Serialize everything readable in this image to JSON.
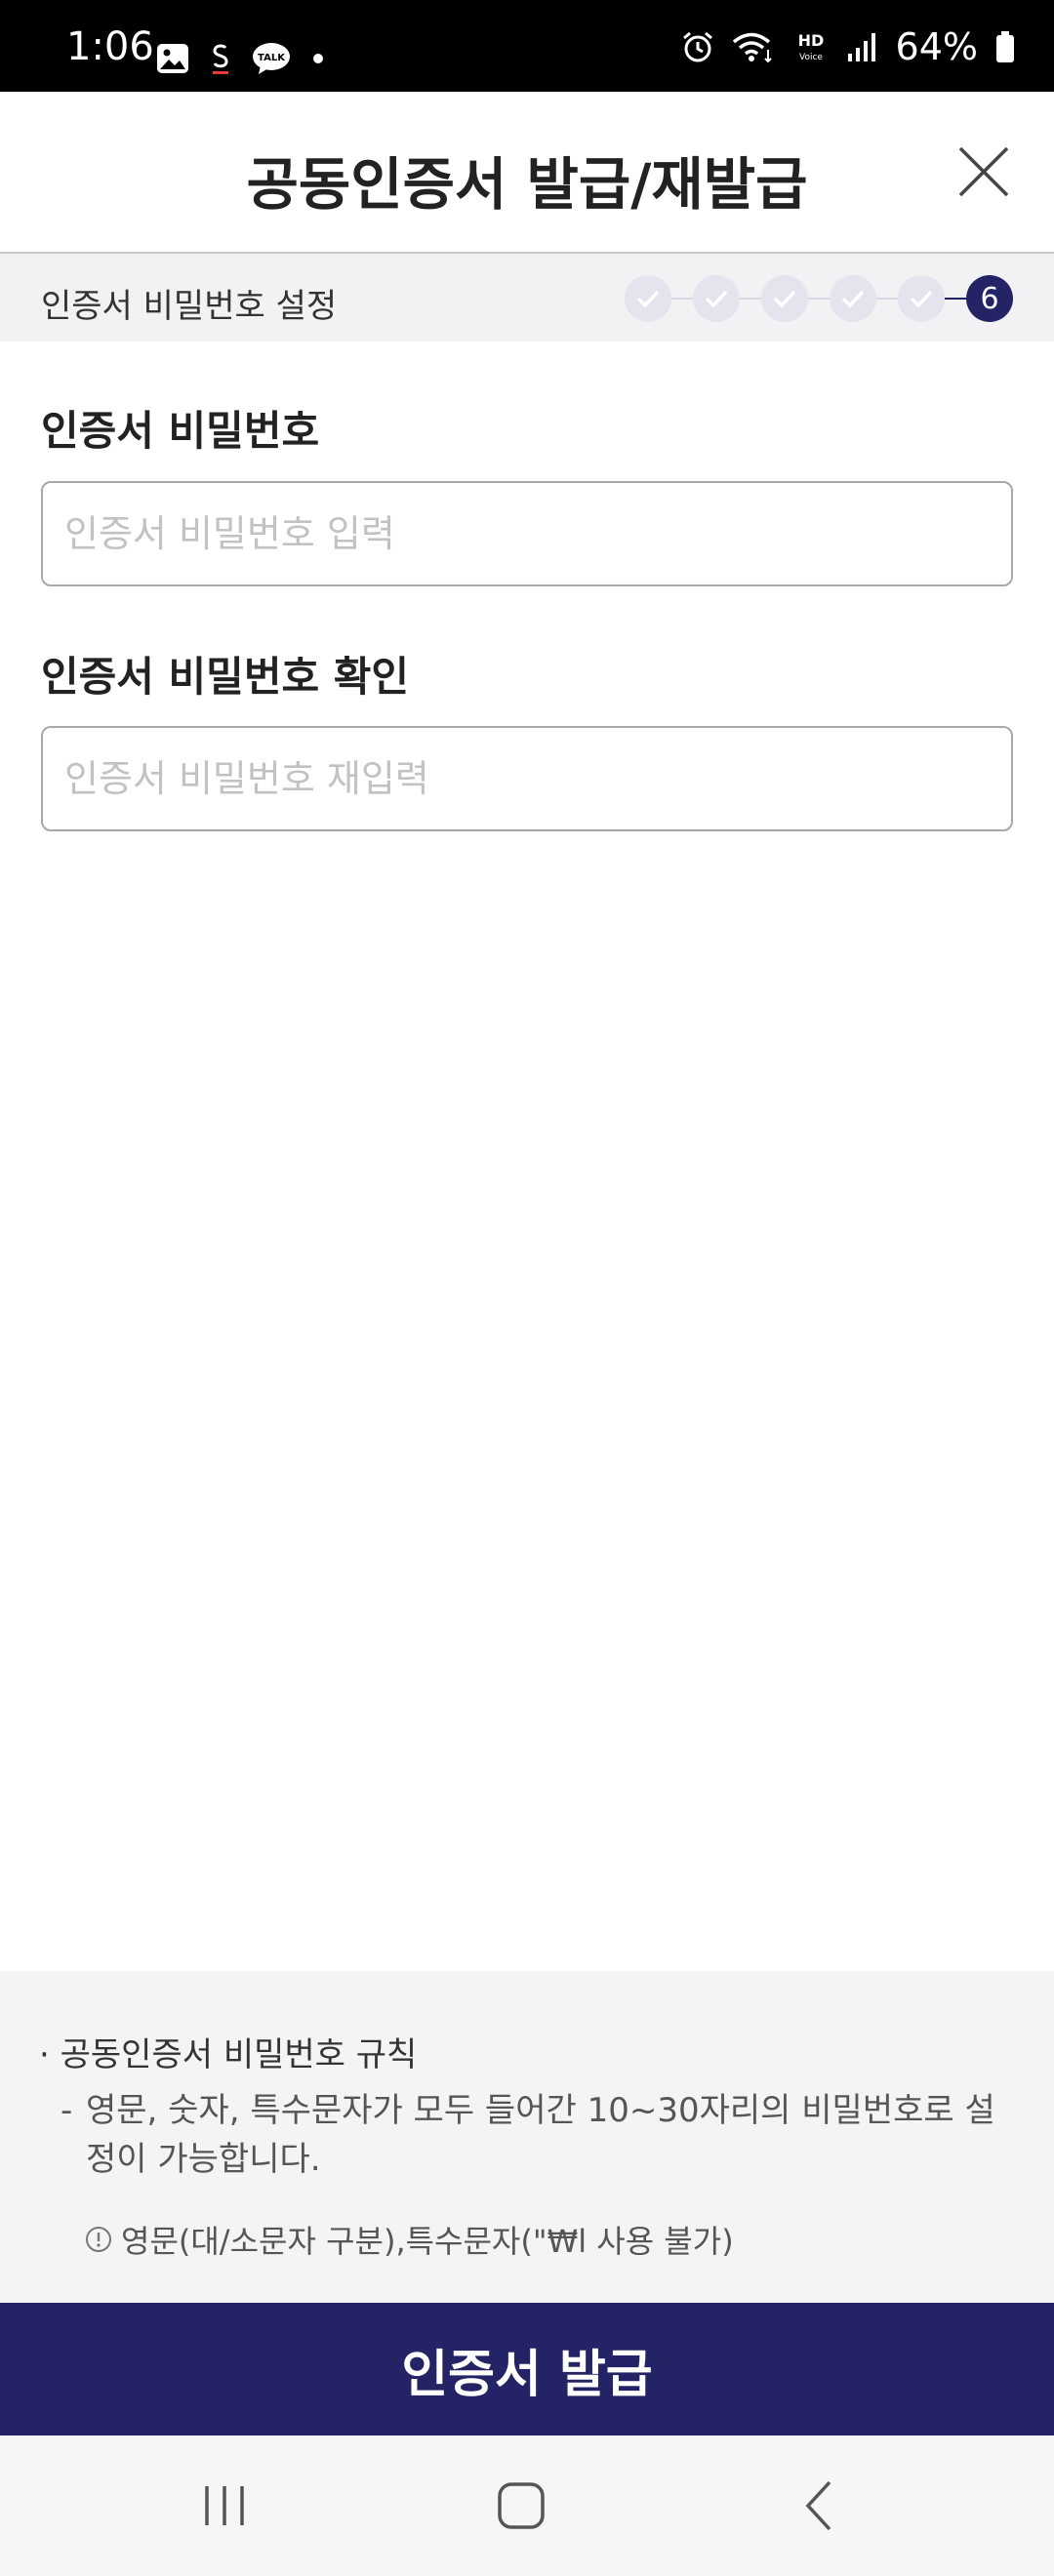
{
  "status_bar": {
    "time": "1:06",
    "battery": "64%",
    "icons_left": [
      "gallery-icon",
      "s-app-icon",
      "talk-icon",
      "dot-icon"
    ],
    "icons_right": [
      "alarm-icon",
      "wifi-icon",
      "hd-voice-icon",
      "signal-icon",
      "battery-icon"
    ]
  },
  "header": {
    "title": "공동인증서 발급/재발급"
  },
  "step_bar": {
    "label": "인증서 비밀번호 설정",
    "completed_steps": 5,
    "current_step": "6"
  },
  "form": {
    "password": {
      "label": "인증서 비밀번호",
      "placeholder": "인증서 비밀번호 입력",
      "value": ""
    },
    "confirm": {
      "label": "인증서 비밀번호 확인",
      "placeholder": "인증서 비밀번호 재입력",
      "value": ""
    }
  },
  "rules": {
    "title": "공동인증서 비밀번호 규칙",
    "dash": "-",
    "description": "영문, 숫자, 특수문자가 모두 들어간 10~30자리의 비밀번호로 설정이 가능합니다.",
    "warning": "영문(대/소문자 구분),특수문자(\"₩l 사용 불가)"
  },
  "primary_button": {
    "label": "인증서 발급"
  },
  "colors": {
    "primary": "#232365",
    "step_done": "#e3e4ee",
    "panel_bg": "#f4f4f4"
  }
}
